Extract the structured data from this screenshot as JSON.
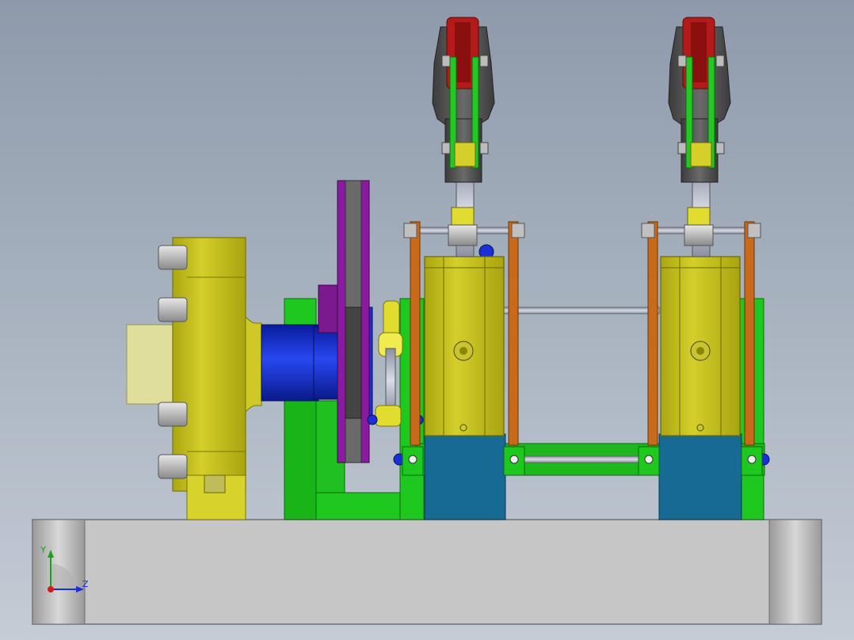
{
  "viewport": {
    "background_top": "#8e9aab",
    "background_bottom": "#c4ccd5"
  },
  "triad": {
    "y_label": "Y",
    "z_label": "Z",
    "y_color": "#1aa31a",
    "z_color": "#1a2fd6",
    "x_color": "#d61a1a"
  },
  "colors": {
    "base": "#c8c8c8",
    "base_edge": "#8a8a8a",
    "frame_green": "#1fc81f",
    "frame_green_dark": "#0f8a0f",
    "yellow": "#c7c21a",
    "yellow_light": "#e0db3c",
    "blue": "#1230d8",
    "blue_dark": "#0a1a8a",
    "purple": "#8a1a9a",
    "teal": "#166a94",
    "grey_rod": "#b8bcc8",
    "red": "#b41a1a",
    "dark_grey": "#555555",
    "orange": "#c96a1a"
  }
}
